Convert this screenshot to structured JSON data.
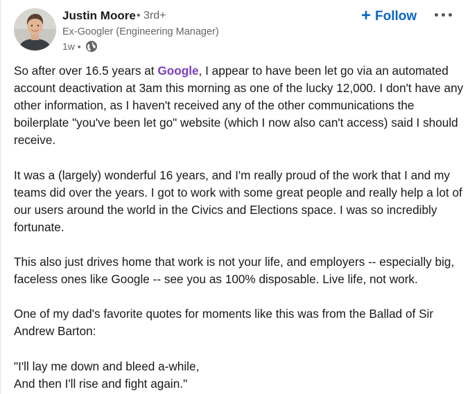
{
  "author": {
    "name": "Justin Moore",
    "degree": "• 3rd+",
    "headline": "Ex-Googler (Engineering Manager)",
    "time": "1w •",
    "visibility_icon": "globe-icon"
  },
  "actions": {
    "follow_icon": "plus-icon",
    "follow_label": "Follow",
    "more_icon": "ellipsis-icon"
  },
  "colors": {
    "follow": "#0a66c2",
    "mention": "#7d3fbf",
    "secondary_text": "#666666"
  },
  "post": {
    "p1_before": "So after over 16.5 years at ",
    "p1_mention": "Google",
    "p1_after": ", I appear to have been let go via an automated account deactivation at 3am this morning as one of the lucky 12,000. I don't have any other information, as I haven't received any of the other communications the boilerplate \"you've been let go\" website (which I now also can't access) said I should receive.",
    "p2": "It was a (largely) wonderful 16 years, and I'm really proud of the work that I and my teams did over the years. I got to work with some great people and really help a lot of our users around the world in the Civics and Elections space. I was so incredibly fortunate.",
    "p3": "This also just drives home that work is not your life, and employers -- especially big, faceless ones like Google -- see you as 100% disposable. Live life, not work.",
    "p4": "One of my dad's favorite quotes for moments like this was from the Ballad of Sir Andrew Barton:",
    "quote_line1": "\"I'll lay me down and bleed a-while,",
    "quote_line2": "And then I'll rise and fight again.\""
  }
}
